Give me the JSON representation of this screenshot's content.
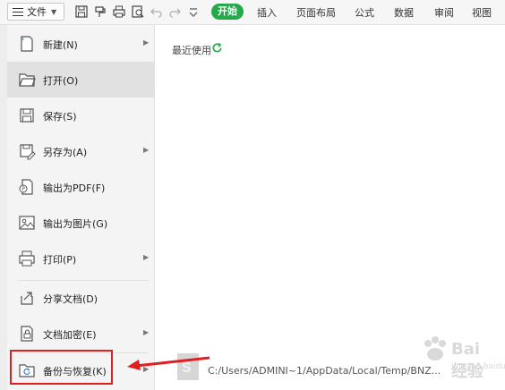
{
  "toolbar": {
    "file_label": "文件",
    "tabs": [
      "开始",
      "插入",
      "页面布局",
      "公式",
      "数据",
      "审阅",
      "视图"
    ]
  },
  "menu": {
    "items": [
      {
        "label": "新建(N)",
        "icon": "new-file-icon",
        "has_submenu": true
      },
      {
        "label": "打开(O)",
        "icon": "folder-open-icon",
        "has_submenu": false
      },
      {
        "label": "保存(S)",
        "icon": "save-icon",
        "has_submenu": false
      },
      {
        "label": "另存为(A)",
        "icon": "save-as-icon",
        "has_submenu": true
      },
      {
        "label": "输出为PDF(F)",
        "icon": "export-pdf-icon",
        "has_submenu": false
      },
      {
        "label": "输出为图片(G)",
        "icon": "export-image-icon",
        "has_submenu": false
      },
      {
        "label": "打印(P)",
        "icon": "print-icon",
        "has_submenu": true
      },
      {
        "label": "分享文档(D)",
        "icon": "share-icon",
        "has_submenu": false
      },
      {
        "label": "文档加密(E)",
        "icon": "encrypt-icon",
        "has_submenu": true
      },
      {
        "label": "备份与恢复(K)",
        "icon": "backup-restore-icon",
        "has_submenu": true
      }
    ]
  },
  "recent": {
    "title": "最近使用",
    "files": [
      {
        "path": "C:/Users/ADMINI~1/AppData/Local/Temp/BNZ..."
      }
    ]
  },
  "watermark": {
    "text": "Bai 经验",
    "sub": "jingyan.baidu.com"
  },
  "colors": {
    "accent_green": "#25a94a",
    "highlight_red": "#e02020"
  }
}
